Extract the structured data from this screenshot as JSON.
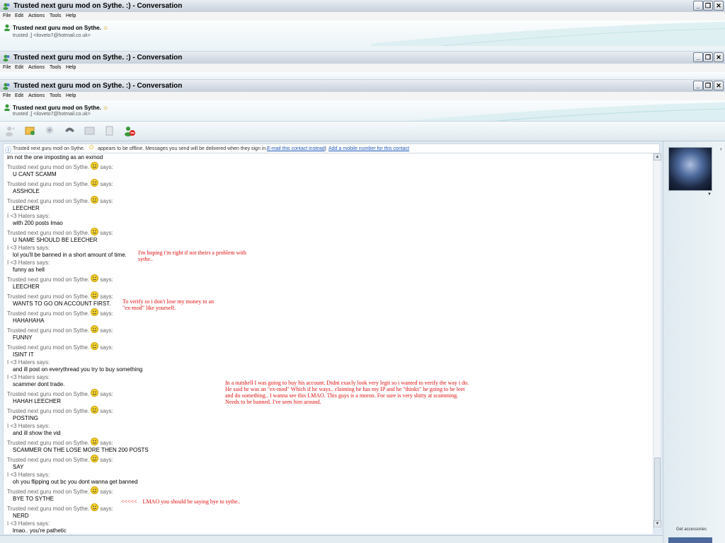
{
  "window": {
    "title": "Trusted next guru mod on Sythe. :) - Conversation",
    "minimize_label": "_",
    "restore_label": "❐",
    "close_label": "✕"
  },
  "menu": [
    "File",
    "Edit",
    "Actions",
    "Tools",
    "Help"
  ],
  "contact": {
    "name": "Trusted next guru mod on Sythe.",
    "status_line": "trusted ;] <iloveto7@hotmail.co.uk>"
  },
  "notice": {
    "prefix": "Trusted next guru mod on Sythe.",
    "message": "appears to be offline. Messages you send will be delivered when they sign in.",
    "link_email": "E-mail this contact instead",
    "separator": "|",
    "link_mobile": "Add a mobile number for this contact"
  },
  "conversation": [
    {
      "sender": "",
      "text": "im not the one imposting as an exmod"
    },
    {
      "sender": "Trusted next guru mod on Sythe.",
      "says": "says:",
      "text": "U CANT SCAMM"
    },
    {
      "sender": "Trusted next guru mod on Sythe.",
      "says": "says:",
      "text": "ASSHOLE"
    },
    {
      "sender": "Trusted next guru mod on Sythe.",
      "says": "says:",
      "text": "LEECHER"
    },
    {
      "sender": "I <3 Haters says:",
      "says": "",
      "text": "with 200 posts lmao"
    },
    {
      "sender": "Trusted next guru mod on Sythe.",
      "says": "says:",
      "text": "U NAME SHOULD BE LEECHER"
    },
    {
      "sender": "I <3 Haters says:",
      "says": "",
      "text": "lol you'll be banned in a short amount of time."
    },
    {
      "sender": "I <3 Haters says:",
      "says": "",
      "text": "funny as hell"
    },
    {
      "sender": "Trusted next guru mod on Sythe.",
      "says": "says:",
      "text": "LEECHER"
    },
    {
      "sender": "Trusted next guru mod on Sythe.",
      "says": "says:",
      "text": "WANTS TO GO ON ACCOUNT FIRST."
    },
    {
      "sender": "Trusted next guru mod on Sythe.",
      "says": "says:",
      "text": "HAHAHAHA"
    },
    {
      "sender": "Trusted next guru mod on Sythe.",
      "says": "says:",
      "text": "FUNNY"
    },
    {
      "sender": "Trusted next guru mod on Sythe.",
      "says": "says:",
      "text": "ISINT IT"
    },
    {
      "sender": "I <3 Haters says:",
      "says": "",
      "text": "and ill post on everythread you try to buy something"
    },
    {
      "sender": "I <3 Haters says:",
      "says": "",
      "text": "scammer dont trade."
    },
    {
      "sender": "Trusted next guru mod on Sythe.",
      "says": "says:",
      "text": "HAHAH LEECHER"
    },
    {
      "sender": "Trusted next guru mod on Sythe.",
      "says": "says:",
      "text": "POSTING"
    },
    {
      "sender": "I <3 Haters says:",
      "says": "",
      "text": "and ill show the vid"
    },
    {
      "sender": "Trusted next guru mod on Sythe.",
      "says": "says:",
      "text": "SCAMMER ON THE LOSE MORE THEN 200 POSTS"
    },
    {
      "sender": "Trusted next guru mod on Sythe.",
      "says": "says:",
      "text": "SAY"
    },
    {
      "sender": "I <3 Haters says:",
      "says": "",
      "text": "oh you flipping out bc you dont wanna get banned"
    },
    {
      "sender": "Trusted next guru mod on Sythe.",
      "says": "says:",
      "text": "BYE TO SYTHE"
    },
    {
      "sender": "Trusted next guru mod on Sythe.",
      "says": "says:",
      "text": "NERD"
    },
    {
      "sender": "I <3 Haters says:",
      "says": "",
      "text": "lmao.. you're pathetic"
    }
  ],
  "annotations": {
    "a1": "I'm hoping i'm right if not theirs a problem with\nsythe..",
    "a2": "To verify so i don't lose my money to an\n\"ex-mod\" like yourself.",
    "a3": "In a nutshell I was going to buy his account. Didnt exacly look very legit so i wanted to verify the way i do.\nHe said he was an \"ex-mod\" Which if he ways.. claiming he has my IP and he \"thinks\" he going to be leet\nand do something.. I wanna see this LMAO. This guys is a moron. For sure is very shitty at scamming.\nNeeds to be banned. I've seen him around.",
    "a4": "<<<<<    LMAO you should be saying bye to sythe.."
  },
  "sidebar": {
    "get_accessories": "Get accessories"
  }
}
